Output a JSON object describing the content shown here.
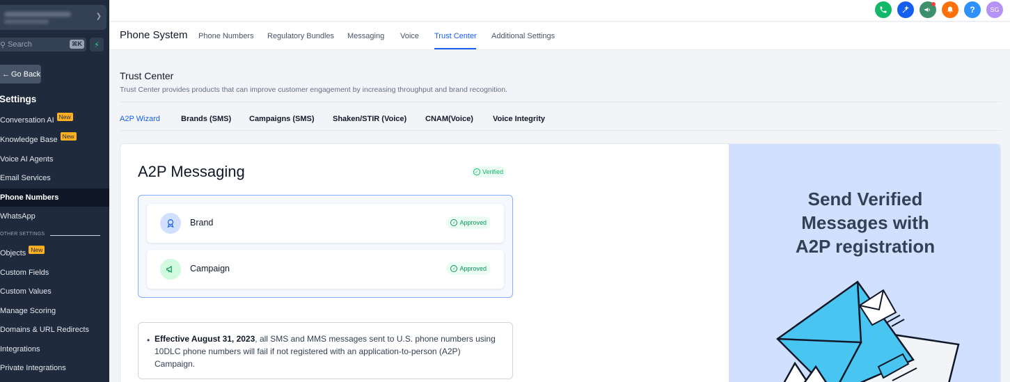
{
  "sidebar": {
    "search_placeholder": "Search",
    "search_shortcut": "⌘K",
    "go_back": "Go Back",
    "section_title": "Settings",
    "items": [
      {
        "label": "Conversation AI",
        "badge": "New"
      },
      {
        "label": "Knowledge Base",
        "badge": "New"
      },
      {
        "label": "Voice AI Agents"
      },
      {
        "label": "Email Services"
      },
      {
        "label": "Phone Numbers",
        "active": true
      },
      {
        "label": "WhatsApp"
      }
    ],
    "other_label": "OTHER SETTINGS",
    "other_items": [
      {
        "label": "Objects",
        "badge": "New"
      },
      {
        "label": "Custom Fields"
      },
      {
        "label": "Custom Values"
      },
      {
        "label": "Manage Scoring"
      },
      {
        "label": "Domains & URL Redirects"
      },
      {
        "label": "Integrations"
      },
      {
        "label": "Private Integrations"
      }
    ]
  },
  "topbar": {
    "icons": [
      {
        "name": "phone-icon",
        "color": "#12b76a",
        "glyph": "✆"
      },
      {
        "name": "magic-icon",
        "color": "#155eef",
        "glyph": "✦"
      },
      {
        "name": "megaphone-icon",
        "color": "#3e8f6b",
        "glyph": "📢"
      },
      {
        "name": "bell-icon",
        "color": "#fd6f0a",
        "glyph": "🔔"
      },
      {
        "name": "help-icon",
        "color": "#2e90fa",
        "glyph": "?"
      }
    ],
    "avatar_initials": "SG",
    "avatar_color": "#b692f6"
  },
  "subnav": {
    "title": "Phone System",
    "tabs": [
      "Phone Numbers",
      "Regulatory Bundles",
      "Messaging",
      "Voice",
      "Trust Center",
      "Additional Settings"
    ],
    "active_tab": "Trust Center"
  },
  "trust_center": {
    "title": "Trust Center",
    "description": "Trust Center provides products that can improve customer engagement by increasing throughput and brand recognition.",
    "tabs": [
      "A2P Wizard",
      "Brands (SMS)",
      "Campaigns (SMS)",
      "Shaken/STIR (Voice)",
      "CNAM(Voice)",
      "Voice Integrity"
    ],
    "active_tab": "A2P Wizard"
  },
  "a2p": {
    "title": "A2P Messaging",
    "status": "Verified",
    "steps": [
      {
        "label": "Brand",
        "status": "Approved"
      },
      {
        "label": "Campaign",
        "status": "Approved"
      }
    ],
    "notice_bold": "Effective August 31, 2023",
    "notice_text": ", all SMS and MMS messages sent to U.S. phone numbers using 10DLC phone numbers will fail if not registered with an application-to-person (A2P) Campaign."
  },
  "promo": {
    "line1": "Send Verified",
    "line2": "Messages with",
    "line3": "A2P registration"
  },
  "colors": {
    "accent": "#155eef",
    "success": "#12b76a",
    "sidebar_bg": "#1f2a3d",
    "promo_bg": "#d1e0ff"
  }
}
